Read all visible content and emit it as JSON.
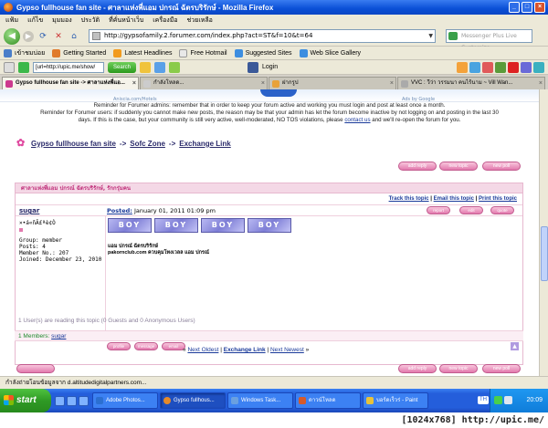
{
  "window": {
    "title": "Gypso fullhouse fan site - ศาลาแห่งพี่แอม ปกรณ์ ฉัตรบริรักษ์ - Mozilla Firefox"
  },
  "menu": [
    "แฟ้ม",
    "แก้ไข",
    "มุมมอง",
    "ประวัติ",
    "ที่คั่นหน้าเว็บ",
    "เครื่องมือ",
    "ช่วยเหลือ"
  ],
  "nav": {
    "url": "http://gypsofamily.2.forumer.com/index.php?act=ST&f=10&t=64",
    "search_placeholder": "Messenger Plus Live Customize"
  },
  "bookmarks": [
    "เข้าชมบ่อย",
    "Getting Started",
    "Latest Headlines",
    "Free Hotmail",
    "Suggested Sites",
    "Web Slice Gallery"
  ],
  "toolbar3": {
    "input": "[url=http://upic.me/show/",
    "search_label": "Search",
    "login": "Login"
  },
  "tabs": [
    {
      "label": "Gypso fullhouse fan site -> ศาลาแห่งพี่แอ...",
      "active": true
    },
    {
      "label": "กำลังโหลด...",
      "active": false
    },
    {
      "label": "ฝากรูป",
      "active": false
    },
    {
      "label": "VVC : วีว่า วรรมนา คนไร้นาม ~ Vill Wan...",
      "active": false
    }
  ],
  "ad": {
    "left": "Aniscia.com/Hotels",
    "right": "Ads by Google"
  },
  "notice": {
    "line1": "Reminder for Forumer admins: remember that in order to keep your forum active and working you must login and post at least once a month.",
    "line2": "Reminder for Forumer users: if suddenly you cannot make new posts, the reason may be that your admin has let the forum become inactive by not logging on and posting in the last 30 days. If this is the case, but your community is still very active, well-moderated, NO TOS violations, please",
    "link": "contact us",
    "line3": "and we'll re-open the forum for you."
  },
  "breadcrumb": {
    "a": "Gypso fullhouse fan site",
    "sep1": "->",
    "b": "Sofc Zone",
    "sep2": "->",
    "c": "Exchange Link"
  },
  "buttons": {
    "add_reply": "add reply",
    "new_topic": "new topic",
    "new_poll": "new poll",
    "report": "report",
    "edit": "edit",
    "quote": "quote",
    "profile": "profile",
    "message": "message",
    "email": "email"
  },
  "topic": {
    "header": "ศาลาแห่งพี่แอม ปกรณ์ ฉัตรบริรักษ์, รักกรุ่มคน",
    "track": "Track this topic",
    "email": "Email this topic",
    "print": "Print this topic",
    "sep": "|"
  },
  "post": {
    "username": "sugar",
    "posted_label": "Posted:",
    "posted_date": "January 01, 2011 01:09 pm",
    "title_line": "×•á«ñÃ£ªè¢Ò",
    "group": "Group: member",
    "posts": "Posts: 4",
    "member_no": "Member No.: 207",
    "joined": "Joined: December 23, 2010",
    "badges": [
      "BOY",
      "BOY",
      "BOY",
      "BOY"
    ],
    "sig1": "แอม ปกรณ์ ฉัตรบริรักษ์",
    "sig2": "pakornclub.com ควบคุมโทงเวลล แอม ปกรณ์"
  },
  "readers": {
    "text": "1 User(s) are reading this topic (0 Guests and 0 Anonymous Users)",
    "members_label": "1 Members:",
    "member": "sugar"
  },
  "pager": {
    "open": "«",
    "oldest": "Next Oldest",
    "sep": "|",
    "current": "Exchange Link",
    "newest": "Next Newest",
    "close": "»"
  },
  "status": "กำลังถ่ายโอนข้อมูลจาก d.altitudedigitalpartners.com...",
  "taskbar": {
    "start": "start",
    "items": [
      "Adobe Photos...",
      "Gypso fullhous...",
      "Windows Task...",
      "ดาวน์โหลด",
      "บอร์ดเร็วร่ - Paint"
    ],
    "lang": "TH",
    "clock": "20:09"
  },
  "watermark": "[1024x768] http://upic.me/",
  "colors": {
    "accent_pink": "#e27aae",
    "link_blue": "#1a3a9a",
    "xp_blue": "#245edb"
  }
}
